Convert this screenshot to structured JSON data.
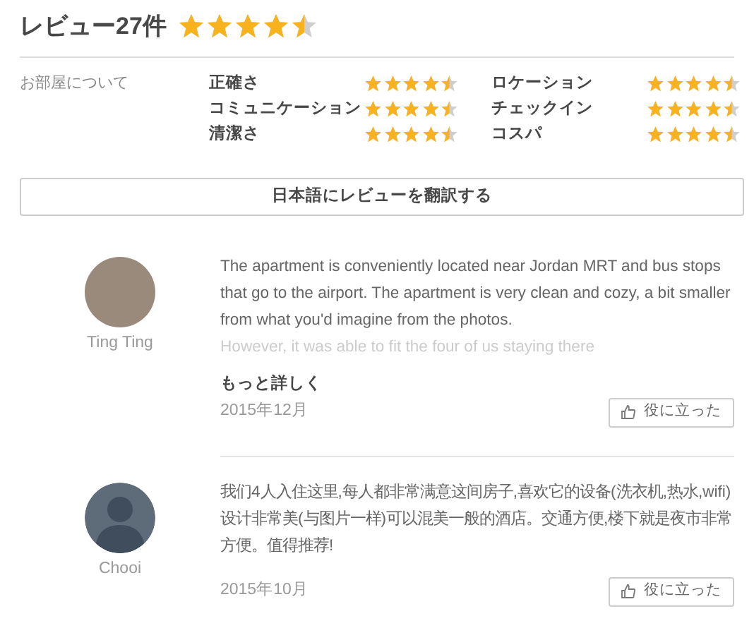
{
  "header": {
    "title": "レビュー27件",
    "stars": 4.5
  },
  "category_label": "お部屋について",
  "ratings": [
    {
      "label": "正確さ",
      "stars": 4.5
    },
    {
      "label": "ロケーション",
      "stars": 4.5
    },
    {
      "label": "コミュニケーション",
      "stars": 4.5
    },
    {
      "label": "チェックイン",
      "stars": 4.5
    },
    {
      "label": "清潔さ",
      "stars": 4.5
    },
    {
      "label": "コスパ",
      "stars": 4.5
    }
  ],
  "translate_button": "日本語にレビューを翻訳する",
  "reviews": [
    {
      "author": "Ting Ting",
      "kind": "photo",
      "text": "The apartment is conveniently located near Jordan MRT and bus stops that go to the airport. The apartment is very clean and cozy, a bit smaller from what you'd imagine from the photos.",
      "faded_text": "However, it was able to fit the four of us staying there",
      "more_link": "もっと詳しく",
      "date": "2015年12月",
      "helpful_button": "役に立った"
    },
    {
      "author": "Chooi",
      "kind": "silhouette",
      "text": "我们4人入住这里,每人都非常满意这间房子,喜欢它的设备(洗衣机,热水,wifi) 设计非常美(与图片一样)可以混美一般的酒店。交通方便,楼下就是夜市非常方便。值得推荐!",
      "date": "2015年10月",
      "helpful_button": "役に立った"
    }
  ]
}
